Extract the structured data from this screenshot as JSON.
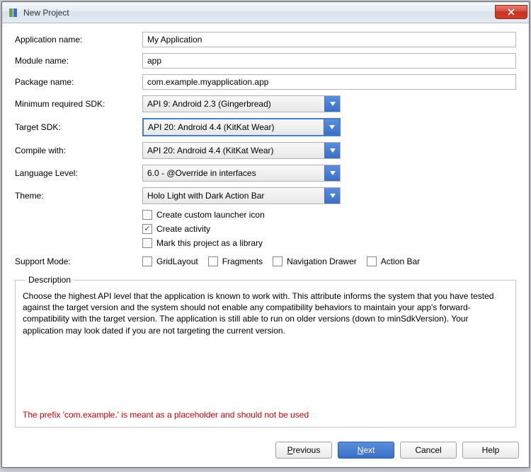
{
  "window": {
    "title": "New Project"
  },
  "form": {
    "app_name_label": "Application name:",
    "app_name_value": "My Application",
    "module_name_label": "Module name:",
    "module_name_value": "app",
    "package_label": "Package name:",
    "package_value": "com.example.myapplication.app",
    "min_sdk_label": "Minimum required SDK:",
    "min_sdk_value": "API 9: Android 2.3 (Gingerbread)",
    "target_sdk_label": "Target SDK:",
    "target_sdk_value": "API 20: Android 4.4 (KitKat Wear)",
    "compile_label": "Compile with:",
    "compile_value": "API 20: Android 4.4 (KitKat Wear)",
    "language_label": "Language Level:",
    "language_value": "6.0 - @Override in interfaces",
    "theme_label": "Theme:",
    "theme_value": "Holo Light with Dark Action Bar"
  },
  "checks": {
    "custom_icon": "Create custom launcher icon",
    "create_activity": "Create activity",
    "mark_library": "Mark this project as a library"
  },
  "support": {
    "label": "Support Mode:",
    "gridlayout": "GridLayout",
    "fragments": "Fragments",
    "navdrawer": "Navigation Drawer",
    "actionbar": "Action Bar"
  },
  "description": {
    "legend": "Description",
    "text": "Choose the highest API level that the application is known to work with. This attribute informs the system that you have tested against the target version and the system should not enable any compatibility behaviors to maintain your app's forward-compatibility with the target version. The application is still able to run on older versions (down to minSdkVersion). Your application may look dated if you are not targeting the current version.",
    "warning": "The prefix 'com.example.' is meant as a placeholder and should not be used"
  },
  "buttons": {
    "previous": "Previous",
    "next": "Next",
    "cancel": "Cancel",
    "help": "Help"
  }
}
